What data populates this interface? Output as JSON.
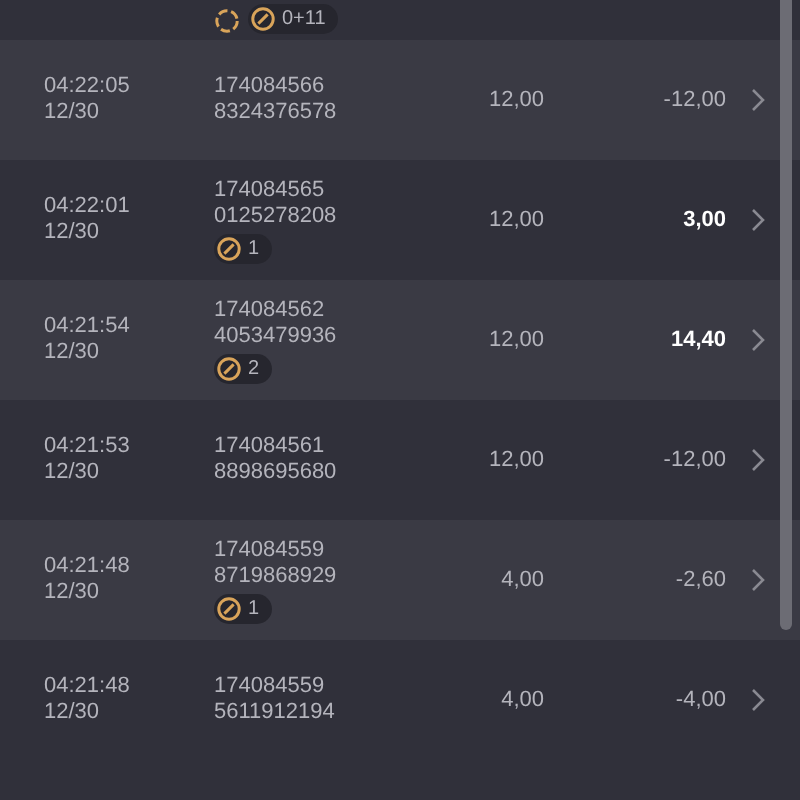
{
  "partial_row": {
    "badges": [
      {
        "kind": "spinner"
      },
      {
        "kind": "count",
        "count": "0+11"
      }
    ]
  },
  "rows": [
    {
      "time": "04:22:05",
      "date": "12/30",
      "id_line1": "174084566",
      "id_line2": "8324376578",
      "amount": "12,00",
      "result": "-12,00",
      "win": false
    },
    {
      "time": "04:22:01",
      "date": "12/30",
      "id_line1": "174084565",
      "id_line2": "0125278208",
      "badge": "1",
      "amount": "12,00",
      "result": "3,00",
      "win": true
    },
    {
      "time": "04:21:54",
      "date": "12/30",
      "id_line1": "174084562",
      "id_line2": "4053479936",
      "badge": "2",
      "amount": "12,00",
      "result": "14,40",
      "win": true
    },
    {
      "time": "04:21:53",
      "date": "12/30",
      "id_line1": "174084561",
      "id_line2": "8898695680",
      "amount": "12,00",
      "result": "-12,00",
      "win": false
    },
    {
      "time": "04:21:48",
      "date": "12/30",
      "id_line1": "174084559",
      "id_line2": "8719868929",
      "badge": "1",
      "amount": "4,00",
      "result": "-2,60",
      "win": false
    },
    {
      "time": "04:21:48",
      "date": "12/30",
      "id_line1": "174084559",
      "id_line2": "5611912194",
      "amount": "4,00",
      "result": "-4,00",
      "win": false
    }
  ]
}
